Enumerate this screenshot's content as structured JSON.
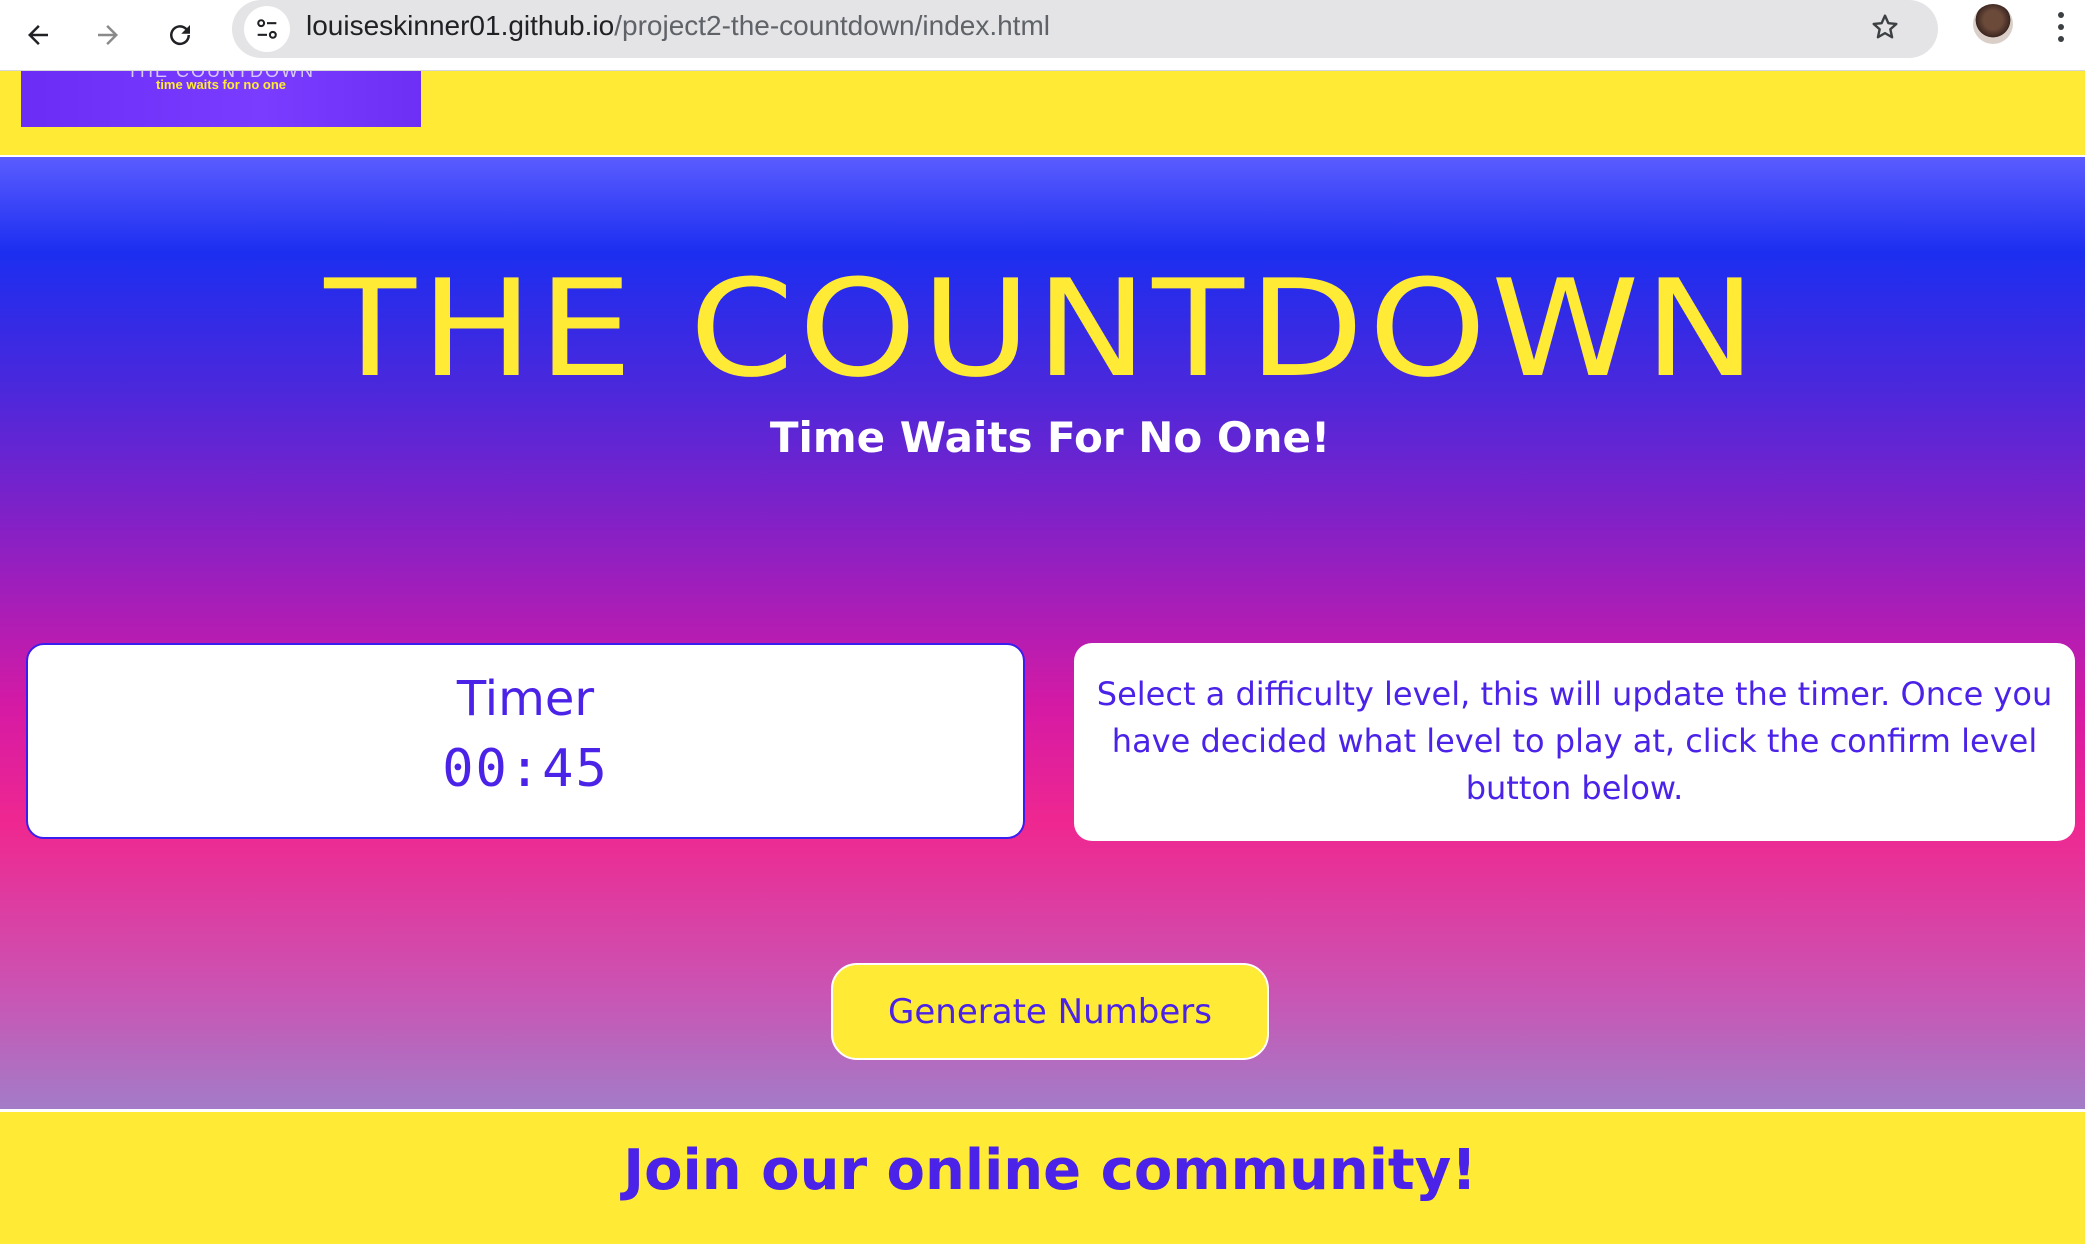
{
  "browser": {
    "url_host": "louiseskinner01.github.io",
    "url_path": "/project2-the-countdown/index.html",
    "back_icon": "arrow-left-icon",
    "forward_icon": "arrow-right-icon",
    "reload_icon": "reload-icon",
    "site_info_icon": "tune-icon",
    "bookmark_icon": "star-icon",
    "menu_icon": "kebab-menu-icon"
  },
  "header": {
    "logo_title": "THE COUNTDOWN",
    "logo_tagline": "time waits for no one"
  },
  "hero": {
    "title": "THE COUNTDOWN",
    "subtitle": "Time Waits For No One!"
  },
  "timer": {
    "label": "Timer",
    "value": "00:45"
  },
  "info": {
    "text": "Select a difficulty level, this will update the timer. Once you have decided what level to play at, click the confirm level button below."
  },
  "actions": {
    "generate_label": "Generate Numbers"
  },
  "footer": {
    "title": "Join our online community!"
  },
  "colors": {
    "yellow": "#ffea36",
    "purple_text": "#4a22e8",
    "blue": "#1c2ef0",
    "pink": "#ef2790"
  }
}
